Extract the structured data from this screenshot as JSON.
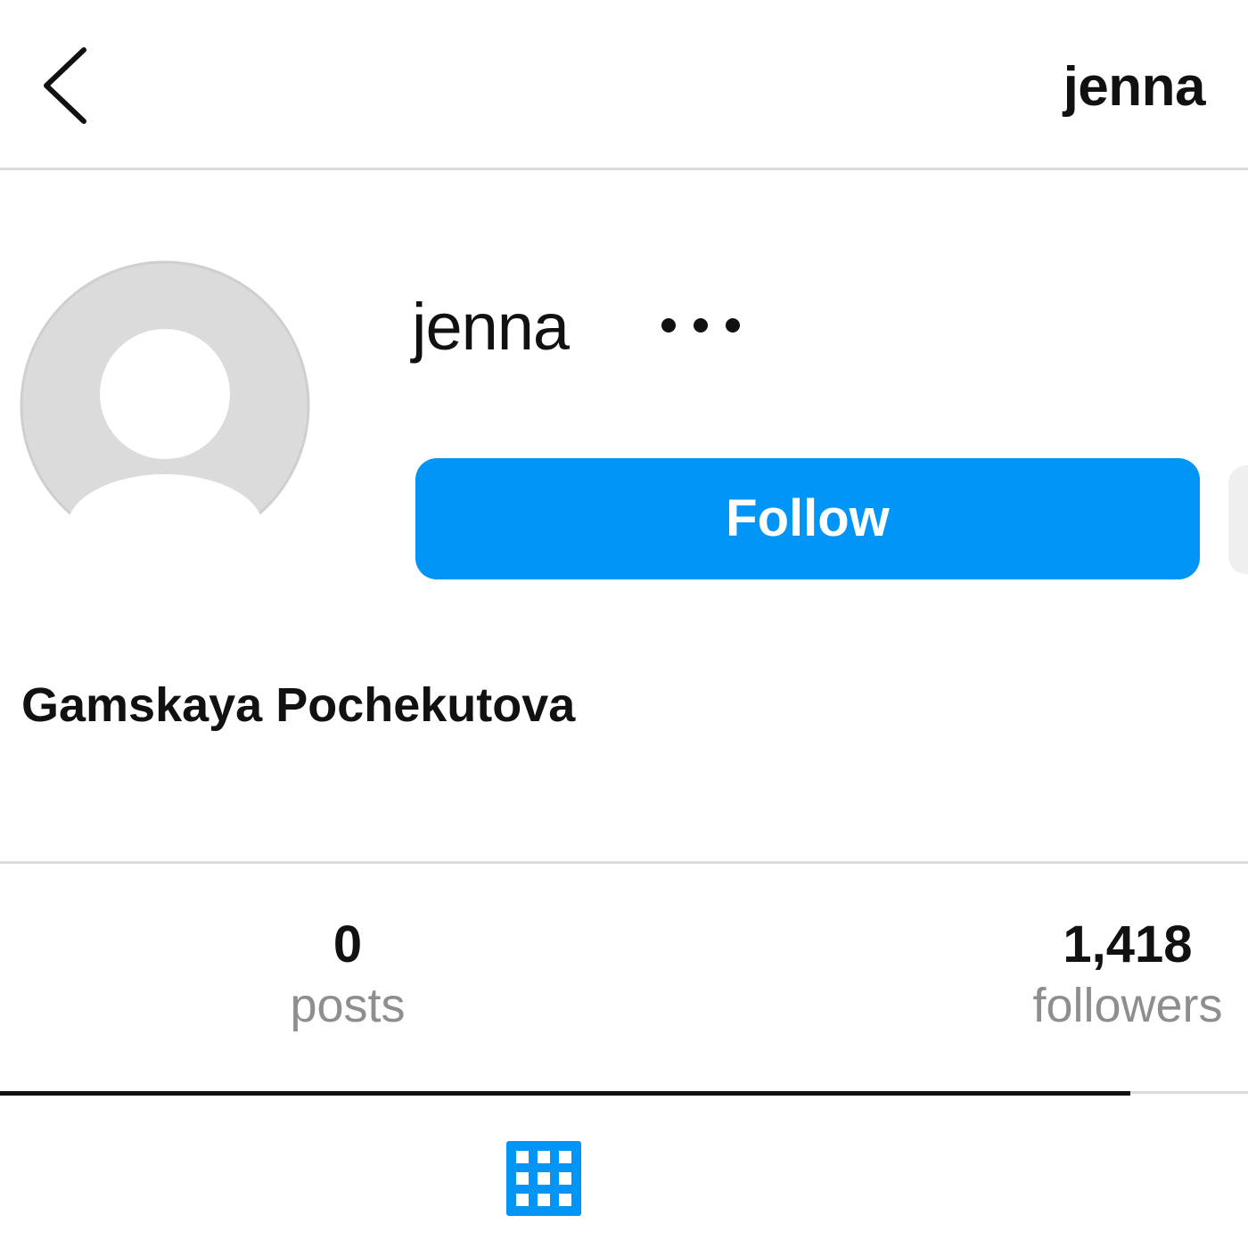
{
  "header": {
    "title": "jenna",
    "back_icon": "chevron-left-icon"
  },
  "profile": {
    "avatar_icon": "default-avatar-icon",
    "username": "jenna",
    "more_icon": "more-horizontal-icon",
    "follow_label": "Follow",
    "full_name": "Gamskaya Pochekutova"
  },
  "stats": {
    "posts": {
      "value": "0",
      "label": "posts"
    },
    "followers": {
      "value": "1,418",
      "label": "followers"
    }
  },
  "tabs": {
    "grid_icon": "grid-icon"
  },
  "colors": {
    "accent": "#0095f6",
    "text": "#111111",
    "muted": "#8e8e8e",
    "divider": "#dbdbdb",
    "avatar_bg": "#dbdbdb"
  }
}
